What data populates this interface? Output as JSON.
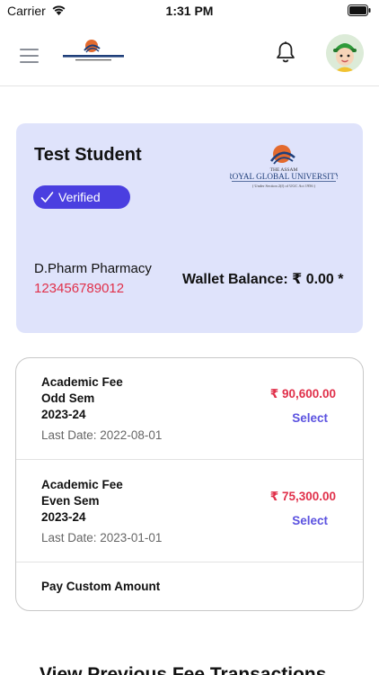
{
  "status_bar": {
    "carrier": "Carrier",
    "time": "1:31 PM"
  },
  "header": {
    "menu_icon": "hamburger-menu-icon",
    "logo": "royal-global-university-logo",
    "notification_icon": "bell-icon",
    "avatar": "user-avatar"
  },
  "student_card": {
    "name": "Test Student",
    "verified_label": "Verified",
    "university_logo": {
      "line1": "THE ASSAM",
      "line2": "ROYAL GLOBAL UNIVERSITY",
      "line3": "( Under Section 2(f) of UGC Act 1956 )"
    },
    "course": "D.Pharm Pharmacy",
    "student_id": "123456789012",
    "wallet_balance": "Wallet Balance: ₹ 0.00 *"
  },
  "fees": [
    {
      "title": [
        "Academic Fee",
        "Odd Sem",
        "2023-24"
      ],
      "last_date": "Last Date: 2022-08-01",
      "amount": "₹ 90,600.00",
      "select_label": "Select"
    },
    {
      "title": [
        "Academic Fee",
        "Even Sem",
        "2023-24"
      ],
      "last_date": "Last Date: 2023-01-01",
      "amount": "₹ 75,300.00",
      "select_label": "Select"
    }
  ],
  "custom_amount_label": "Pay Custom Amount",
  "bottom_heading": "View Previous Fee Transactions",
  "colors": {
    "card_bg": "#dfe3fb",
    "badge": "#4a3fe0",
    "amount": "#e0304a",
    "select": "#5b52e0"
  }
}
